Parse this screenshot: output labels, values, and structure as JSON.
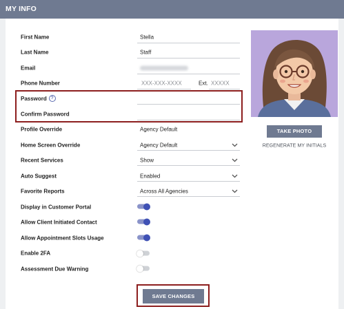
{
  "header": {
    "title": "MY INFO"
  },
  "form": {
    "first_name": {
      "label": "First Name",
      "value": "Stella"
    },
    "last_name": {
      "label": "Last Name",
      "value": "Staff"
    },
    "email": {
      "label": "Email"
    },
    "phone": {
      "label": "Phone Number",
      "placeholder": "XXX-XXX-XXXX",
      "ext_label": "Ext.",
      "ext_placeholder": "XXXXX"
    },
    "password": {
      "label": "Password",
      "help_icon": "help-circle-icon"
    },
    "confirm_password": {
      "label": "Confirm Password"
    },
    "profile_override": {
      "label": "Profile Override",
      "value": "Agency Default"
    },
    "home_screen_override": {
      "label": "Home Screen Override",
      "value": "Agency Default"
    },
    "recent_services": {
      "label": "Recent Services",
      "value": "Show"
    },
    "auto_suggest": {
      "label": "Auto Suggest",
      "value": "Enabled"
    },
    "favorite_reports": {
      "label": "Favorite Reports",
      "value": "Across All Agencies"
    },
    "toggles": [
      {
        "label": "Display in Customer Portal",
        "on": true
      },
      {
        "label": "Allow Client Initiated Contact",
        "on": true
      },
      {
        "label": "Allow Appointment Slots Usage",
        "on": true
      },
      {
        "label": "Enable 2FA",
        "on": false
      },
      {
        "label": "Assessment Due Warning",
        "on": false
      }
    ]
  },
  "profile": {
    "take_photo_label": "TAKE PHOTO",
    "regenerate_label": "REGENERATE MY INITIALS"
  },
  "actions": {
    "save_label": "SAVE CHANGES"
  },
  "colors": {
    "header_bg": "#6f7a91",
    "accent": "#3f51b5",
    "highlight_border": "#8c1d1d",
    "avatar_bg": "#b9a6dc"
  }
}
